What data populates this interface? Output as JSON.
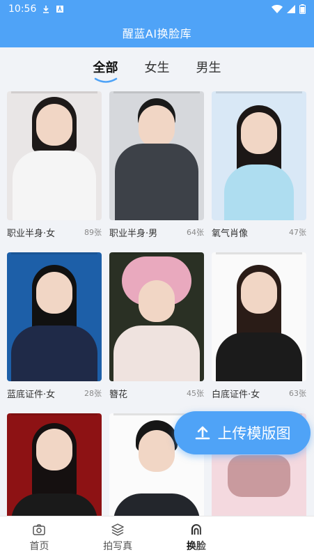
{
  "status": {
    "time": "10:56"
  },
  "app": {
    "title": "醒蓝AI换脸库"
  },
  "tabs": [
    {
      "label": "全部",
      "active": true
    },
    {
      "label": "女生",
      "active": false
    },
    {
      "label": "男生",
      "active": false
    }
  ],
  "cards": [
    {
      "name": "职业半身·女",
      "count": "89张"
    },
    {
      "name": "职业半身·男",
      "count": "64张"
    },
    {
      "name": "氧气肖像",
      "count": "47张"
    },
    {
      "name": "蓝底证件·女",
      "count": "28张"
    },
    {
      "name": "簪花",
      "count": "45张"
    },
    {
      "name": "白底证件·女",
      "count": "63张"
    }
  ],
  "upload": {
    "label": "上传模版图"
  },
  "nav": [
    {
      "label": "首页",
      "icon": "camera-icon"
    },
    {
      "label": "拍写真",
      "icon": "layers-icon"
    },
    {
      "label": "换脸",
      "icon": "face-icon",
      "active": true
    }
  ],
  "colors": {
    "primary": "#4fa3f7"
  }
}
